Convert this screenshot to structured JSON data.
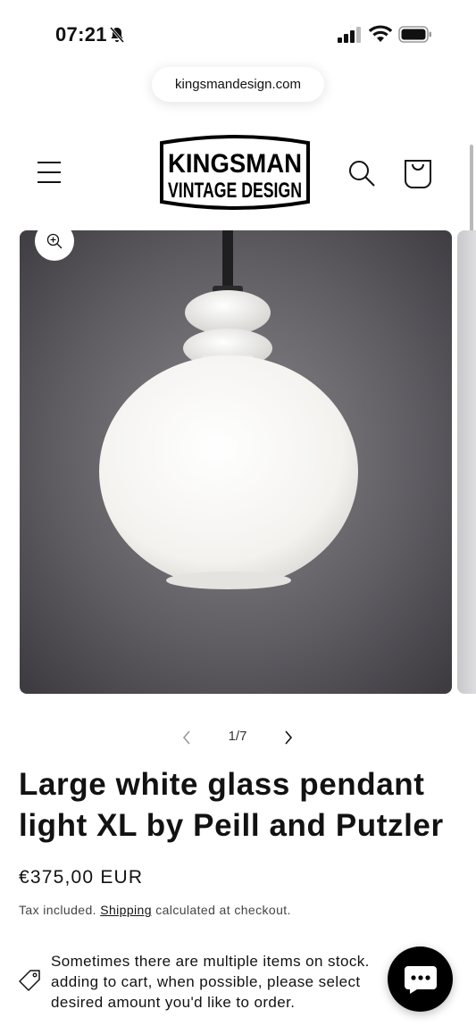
{
  "status_bar": {
    "time": "07:21"
  },
  "browser": {
    "url": "kingsmandesign.com"
  },
  "header": {
    "logo_line1": "KINGSMAN",
    "logo_line2": "VINTAGE DESIGN"
  },
  "gallery": {
    "counter": "1/7"
  },
  "product": {
    "title": "Large white glass pendant light XL by Peill and Putzler",
    "price": "€375,00 EUR",
    "tax_prefix": "Tax included.",
    "shipping_link": "Shipping",
    "tax_suffix": "calculated at checkout.",
    "notice": "Sometimes there are multiple items on stock. adding to cart, when possible, please select desired amount you'd like to order."
  },
  "icons": [
    "bell-slash-icon",
    "signal-icon",
    "wifi-icon",
    "battery-icon",
    "menu-icon",
    "search-icon",
    "cart-icon",
    "zoom-icon",
    "chevron-left-icon",
    "chevron-right-icon",
    "tag-icon",
    "chat-icon"
  ],
  "colors": {
    "text": "#121212",
    "background": "#ffffff",
    "image_bg": "#5f5c62",
    "chat_button": "#000000"
  }
}
